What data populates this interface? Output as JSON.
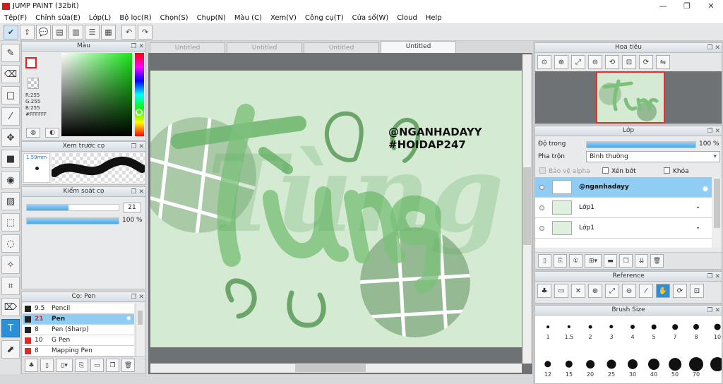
{
  "window": {
    "title": "JUMP PAINT (32bit)",
    "controls": [
      "—",
      "❐",
      "✕"
    ]
  },
  "menu": [
    "Tệp(F)",
    "Chỉnh sửa(E)",
    "Lớp(L)",
    "Bộ lọc(R)",
    "Chọn(S)",
    "Chụp(N)",
    "Màu (C)",
    "Xem(V)",
    "Công cụ(T)",
    "Cửa sổ(W)",
    "Cloud",
    "Help"
  ],
  "color_panel": {
    "title": "Màu",
    "r": "R:255",
    "g": "G:255",
    "b": "B:255",
    "hex": "#FFFFFF",
    "primary": "#ffffff",
    "primary_border": "#e02020"
  },
  "brush_preview": {
    "title": "Xem trước cọ",
    "size": "1.59mm"
  },
  "brush_control": {
    "title": "Kiểm soát cọ",
    "size_value": "21",
    "opacity_value": "100 %",
    "size_fraction": 0.45,
    "opacity_fraction": 1.0
  },
  "brush_list": {
    "title": "Cọ: Pen",
    "items": [
      {
        "size": "9.5",
        "name": "Pencil",
        "color": "#222222",
        "selected": false
      },
      {
        "size": "21",
        "name": "Pen",
        "color": "#222222",
        "selected": true
      },
      {
        "size": "8",
        "name": "Pen (Sharp)",
        "color": "#222222",
        "selected": false
      },
      {
        "size": "10",
        "name": "G Pen",
        "color": "#e02a2a",
        "selected": false
      },
      {
        "size": "8",
        "name": "Mapping Pen",
        "color": "#e02a2a",
        "selected": false
      }
    ]
  },
  "tabs": [
    {
      "label": "Untitled",
      "active": false
    },
    {
      "label": "Untitled",
      "active": false
    },
    {
      "label": "Untitled",
      "active": false
    },
    {
      "label": "Untitled",
      "active": true
    }
  ],
  "canvas_art": {
    "line1": "@NGANHADAYY",
    "line2": "#HOIDAP247",
    "word": "Tùng"
  },
  "navigator": {
    "title": "Hoa tiêu"
  },
  "layer_panel": {
    "title": "Lớp",
    "opacity_label": "Độ trong",
    "opacity_value": "100 %",
    "opacity_fraction": 1.0,
    "blend_label": "Pha trộn",
    "blend_value": "Bình thường",
    "protect_alpha": "Bảo vệ alpha",
    "clip": "Xén bớt",
    "lock": "Khóa",
    "layers": [
      {
        "name": "@nganhadayy",
        "selected": true
      },
      {
        "name": "Lớp1",
        "selected": false
      },
      {
        "name": "Lớp1",
        "selected": false
      }
    ]
  },
  "reference": {
    "title": "Reference"
  },
  "brush_size": {
    "title": "Brush Size",
    "sizes": [
      {
        "label": "1",
        "value": 1
      },
      {
        "label": "1.5",
        "value": 1.5
      },
      {
        "label": "2",
        "value": 2
      },
      {
        "label": "3",
        "value": 3
      },
      {
        "label": "4",
        "value": 4
      },
      {
        "label": "5",
        "value": 5
      },
      {
        "label": "7",
        "value": 7
      },
      {
        "label": "8",
        "value": 8
      },
      {
        "label": "10",
        "value": 10
      },
      {
        "label": "12",
        "value": 12
      },
      {
        "label": "15",
        "value": 15
      },
      {
        "label": "20",
        "value": 20
      },
      {
        "label": "25",
        "value": 25
      },
      {
        "label": "30",
        "value": 30
      },
      {
        "label": "40",
        "value": 40
      },
      {
        "label": "50",
        "value": 50
      },
      {
        "label": "70",
        "value": 70
      },
      {
        "label": "",
        "value": 80
      }
    ]
  },
  "colors": {
    "accent": "#2c90d8",
    "selection": "#8fcdf5",
    "canvas_bg": "#d5ead3",
    "art_green": "#5fa862"
  }
}
